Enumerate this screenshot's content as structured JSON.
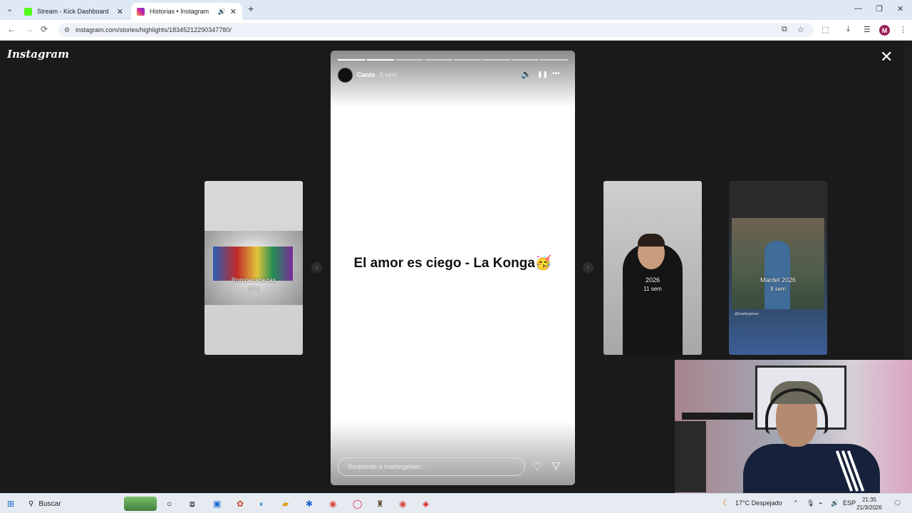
{
  "browser": {
    "tabs": [
      {
        "title": "Stream - Kick Dashboard",
        "favicon_color": "#53fc18",
        "close": "✕"
      },
      {
        "title": "Historias • Instagram",
        "favicon_color": "#d6249f",
        "close": "✕",
        "audio": "🔊"
      }
    ],
    "new_tab": "+",
    "window_controls": {
      "minimize": "—",
      "maximize": "❐",
      "close": "✕"
    },
    "url": "instagram.com/stories/highlights/18345212290347780/",
    "nav": {
      "back": "←",
      "forward": "→",
      "reload": "⟳"
    },
    "profile_initial": "M"
  },
  "instagram": {
    "logo": "Instagram",
    "close": "✕",
    "story": {
      "username": "Canto",
      "time_ago": "3 sem",
      "segments_total": 8,
      "segments_done": 2,
      "caption": "El amor es ciego - La Konga🥳",
      "reply_placeholder": "Responde a martingelvan...",
      "icons": {
        "sound": "🔈",
        "pause": "❚❚",
        "more": "•••",
        "like": "♡",
        "share": "▽"
      }
    },
    "arrows": {
      "prev": "‹",
      "next": "›"
    },
    "highlights": [
      {
        "name": "Rompecabezas",
        "time": "17 h"
      },
      {
        "name": "2026",
        "time": "11 sem"
      },
      {
        "name": "Mardel 2026",
        "time": "9 sem",
        "mention": "@martingelvan"
      }
    ]
  },
  "taskbar": {
    "search": "Buscar",
    "weather": "17°C Despejado",
    "language": "ESP",
    "time": "21:35",
    "date": "21/3/2026"
  }
}
